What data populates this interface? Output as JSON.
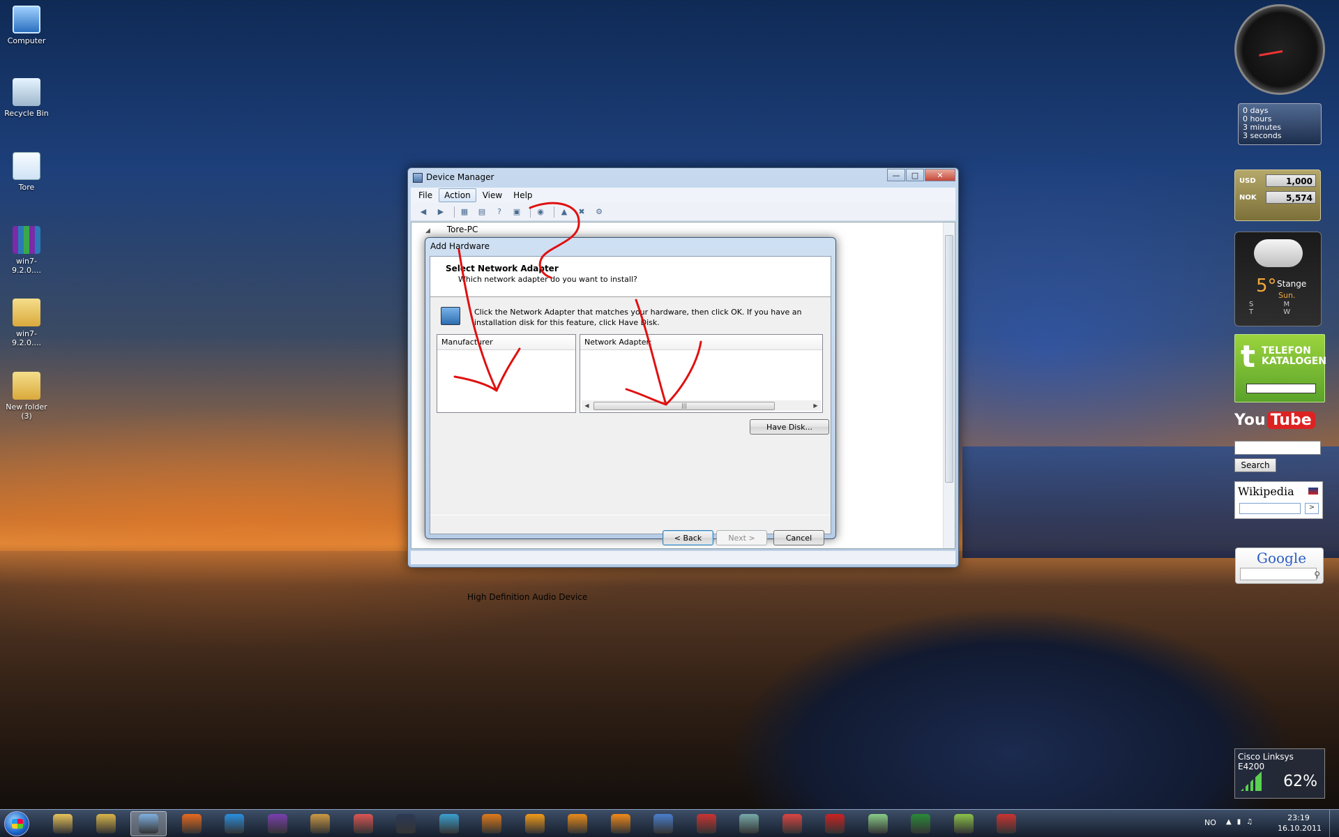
{
  "desktop": {
    "icons": [
      {
        "label": "Computer",
        "icon": "computer-icon"
      },
      {
        "label": "Recycle Bin",
        "icon": "recycle-bin-icon"
      },
      {
        "label": "Tore",
        "icon": "document-icon"
      },
      {
        "label": "win7-9.2.0....",
        "icon": "winrar-archive-icon"
      },
      {
        "label": "win7-9.2.0....",
        "icon": "folder-icon"
      },
      {
        "label": "New folder (3)",
        "icon": "folder-icon"
      }
    ]
  },
  "device_manager": {
    "title": "Device Manager",
    "menu": [
      "File",
      "Action",
      "View",
      "Help"
    ],
    "active_menu": "Action",
    "toolbar_icons": [
      "back-icon",
      "forward-icon",
      "show-hide-tree-icon",
      "properties-icon",
      "help-icon",
      "view-icon",
      "scan-hardware-icon",
      "update-driver-icon",
      "uninstall-icon",
      "disable-icon"
    ],
    "tree_root": "Tore-PC",
    "tree_visible_item": "High Definition Audio Device"
  },
  "add_hardware": {
    "title": "Add Hardware",
    "heading": "Select Network Adapter",
    "subheading": "Which network adapter do you want to install?",
    "description": "Click the Network Adapter that matches your hardware, then click OK. If you have an installation disk for this feature, click Have Disk.",
    "manufacturer_header": "Manufacturer",
    "adapter_header": "Network Adapter:",
    "have_disk": "Have Disk...",
    "back": "< Back",
    "next": "Next >",
    "cancel": "Cancel"
  },
  "gadgets": {
    "uptime": [
      "0 days",
      "0 hours",
      "3 minutes",
      "3 seconds"
    ],
    "currency": [
      {
        "code": "USD",
        "value": "1,000"
      },
      {
        "code": "NOK",
        "value": "5,574"
      }
    ],
    "weather": {
      "temp": "5°",
      "city": "Stange",
      "day": "Sun.",
      "days": "S M T W"
    },
    "telefon": {
      "line1": "TELEFON",
      "line2": "KATALOGEN"
    },
    "youtube": {
      "you": "You",
      "tube": "Tube",
      "search_label": "Search"
    },
    "wikipedia": {
      "logo": "Wikipedia",
      "go": ">"
    },
    "google": {
      "logo": "Google"
    },
    "wifi": {
      "name": "Cisco Linksys E4200",
      "percent": "62%"
    }
  },
  "taskbar": {
    "apps": [
      "explorer-icon",
      "libraries-icon",
      "control-panel-icon",
      "firefox-icon",
      "internet-explorer-icon",
      "cpu-z-icon",
      "notepad-icon",
      "utility-icon",
      "steam-icon",
      "network-icon",
      "media-icon",
      "winamp-icon",
      "media-player-icon",
      "vlc-icon",
      "chrome-icon",
      "winrar-icon",
      "device-manager-icon",
      "tools-icon",
      "no-entry-icon",
      "messenger-icon",
      "utorrent-icon",
      "android-icon",
      "toolbox-icon"
    ],
    "active_app_index": 2,
    "tray_lang": "NO",
    "time": "23:19",
    "date": "16.10.2011"
  },
  "colors": {
    "annotation": "#e01010",
    "window_frame": "#b2c9e3",
    "accent": "#3c7fb1"
  }
}
